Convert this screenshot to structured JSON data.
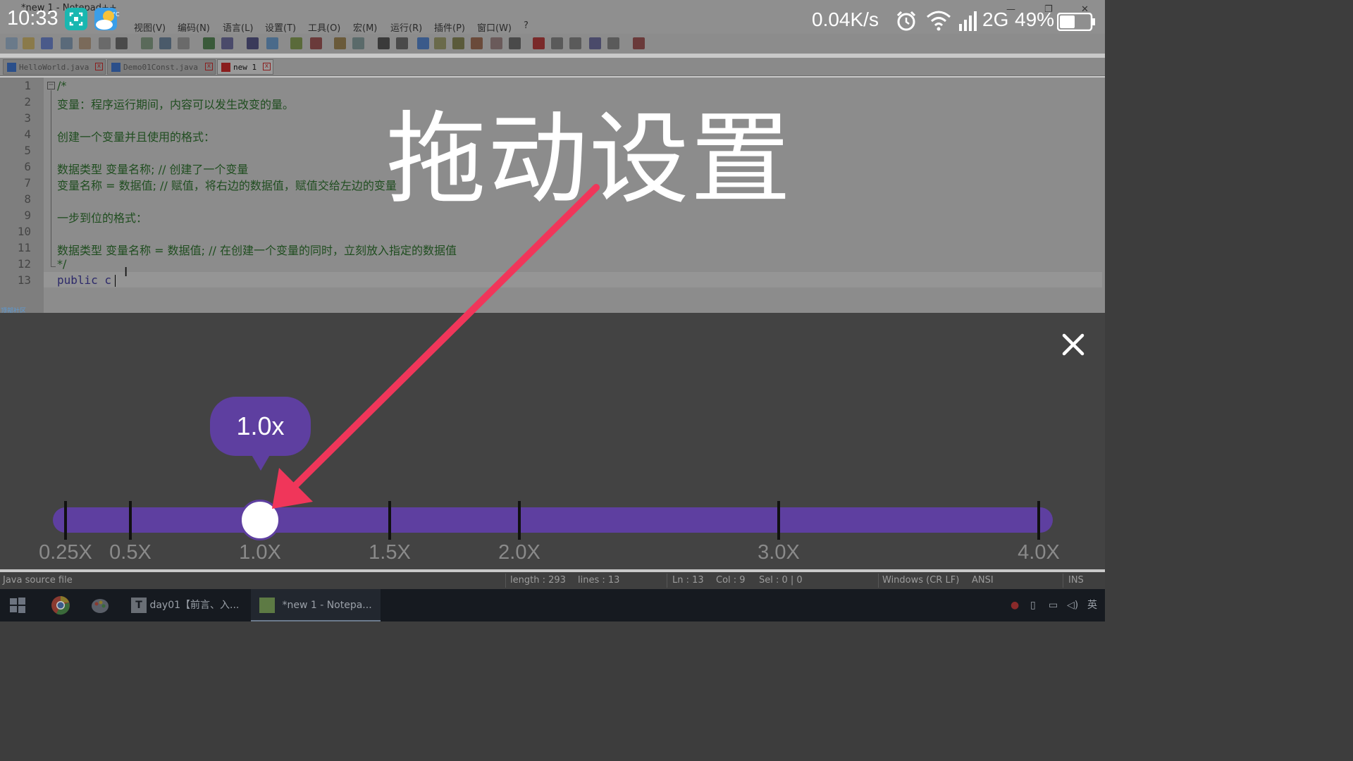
{
  "phone_status": {
    "time": "10:33",
    "net_speed": "0.04K/s",
    "network": "2G",
    "battery": "49%",
    "icons": [
      "screenshot-app-icon",
      "weather-app-icon",
      "alarm-icon",
      "wifi-icon",
      "signal-icon",
      "battery-icon"
    ]
  },
  "window": {
    "title": "*new 1 - Notepad++",
    "menu": [
      "视图(V)",
      "编码(N)",
      "语言(L)",
      "设置(T)",
      "工具(O)",
      "宏(M)",
      "运行(R)",
      "插件(P)",
      "窗口(W)",
      "?"
    ],
    "tabs": [
      {
        "label": "HelloWorld.java",
        "active": false
      },
      {
        "label": "Demo01Const.java",
        "active": false
      },
      {
        "label": "new 1",
        "active": true
      }
    ]
  },
  "editor": {
    "line_numbers": [
      "1",
      "2",
      "3",
      "4",
      "5",
      "6",
      "7",
      "8",
      "9",
      "10",
      "11",
      "12",
      "13"
    ],
    "lines": [
      "/*",
      "变量：程序运行期间，内容可以发生改变的量。",
      "",
      "创建一个变量并且使用的格式：",
      "",
      "数据类型 变量名称; // 创建了一个变量",
      "变量名称 = 数据值; // 赋值，将右边的数据值，赋值交给左边的变量",
      "",
      "一步到位的格式：",
      "",
      "数据类型 变量名称 = 数据值; // 在创建一个变量的同时，立刻放入指定的数据值",
      "*/",
      "public c"
    ],
    "side_label": "顶部社区"
  },
  "status_bar": {
    "file_type": "Java source file",
    "length": "length : 293",
    "lines": "lines : 13",
    "ln": "Ln : 13",
    "col": "Col : 9",
    "sel": "Sel : 0 | 0",
    "eol": "Windows (CR LF)",
    "encoding": "ANSI",
    "mode": "INS"
  },
  "taskbar": {
    "items": [
      {
        "label": "day01【前言、入...",
        "open": false
      },
      {
        "label": "*new 1 - Notepa...",
        "open": true
      }
    ],
    "tray_lang": "英"
  },
  "overlay": {
    "title": "拖动设置",
    "speed_bubble": "1.0x",
    "current_speed": 1.0,
    "speed_marks": [
      "0.25X",
      "0.5X",
      "1.0X",
      "1.5X",
      "2.0X",
      "3.0X",
      "4.0X"
    ],
    "speed_values": [
      0.25,
      0.5,
      1.0,
      1.5,
      2.0,
      3.0,
      4.0
    ],
    "accent_color": "#5e3fa0",
    "arrow_color": "#f0365a"
  }
}
